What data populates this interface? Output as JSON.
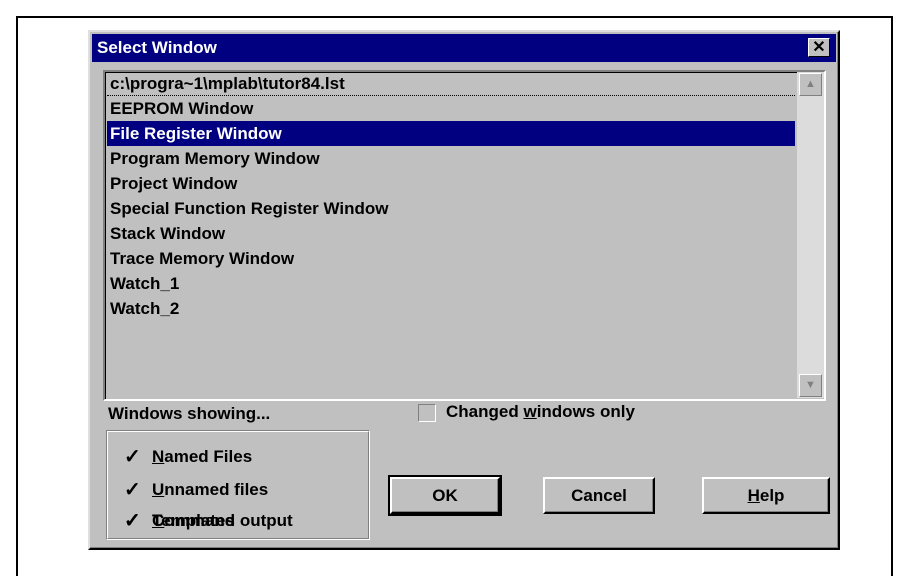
{
  "dialog": {
    "title": "Select Window",
    "close_label": "✕"
  },
  "windows_list": {
    "items": [
      "c:\\progra~1\\mplab\\tutor84.lst",
      "EEPROM Window",
      "File Register Window",
      "Program Memory Window",
      "Project Window",
      "Special Function Register Window",
      "Stack Window",
      "Trace Memory Window",
      "Watch_1",
      "Watch_2"
    ],
    "selected_index": 2,
    "scroll_up": "▲",
    "scroll_down": "▼"
  },
  "windows_showing": {
    "label": "Windows showing...",
    "options": [
      {
        "pre": "",
        "key": "N",
        "post": "amed Files",
        "checked": true
      },
      {
        "pre": "",
        "key": "U",
        "post": "nnamed files",
        "checked": true
      },
      {
        "pre": "",
        "key": "T",
        "post": "emplates",
        "checked": true
      },
      {
        "pre": "",
        "key": "C",
        "post": "ommand output",
        "checked": true
      }
    ],
    "check_glyph": "✓"
  },
  "changed_only": {
    "pre": "Changed ",
    "key": "w",
    "post": "indows only",
    "checked": false
  },
  "buttons": {
    "ok": "OK",
    "cancel": "Cancel",
    "help_key": "H",
    "help_rest": "elp"
  },
  "colors": {
    "titlebar": "#000080",
    "face": "#c0c0c0",
    "selection": "#000080"
  }
}
